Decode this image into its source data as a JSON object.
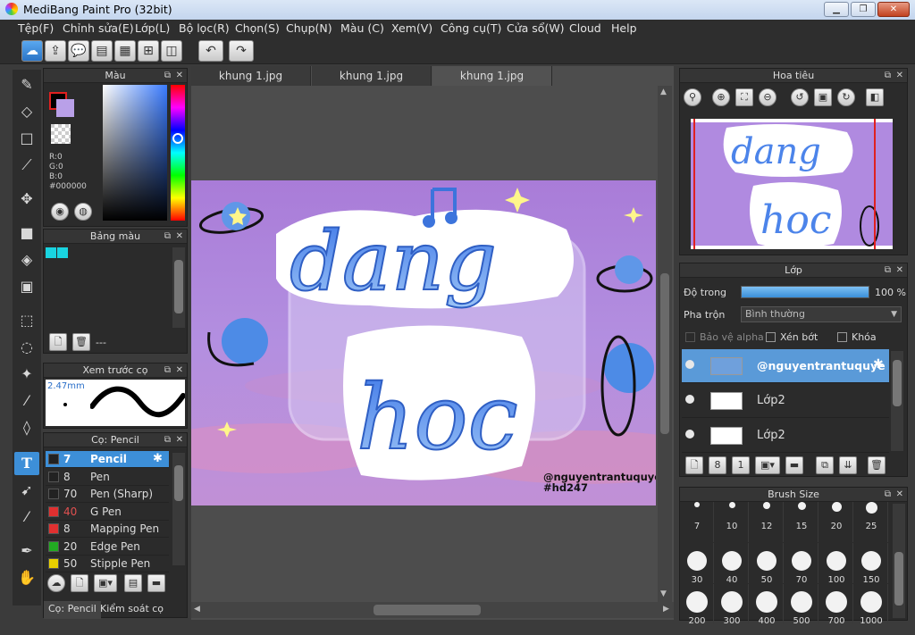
{
  "window": {
    "title": "MediBang Paint Pro (32bit)",
    "btn_min": "▁",
    "btn_max": "❐",
    "btn_close": "✕"
  },
  "menu": [
    "Tệp(F)",
    "Chỉnh sửa(E)",
    "Lớp(L)",
    "Bộ lọc(R)",
    "Chọn(S)",
    "Chụp(N)",
    "Màu (C)",
    "Xem(V)",
    "Công cụ(T)",
    "Cửa sổ(W)",
    "Cloud",
    "Help"
  ],
  "toolbar_icons": [
    "cloud-icon",
    "upload-icon",
    "comment-icon",
    "chat-icon",
    "page-icon",
    "grid-icon",
    "panel-icon",
    "undo-icon",
    "redo-icon"
  ],
  "tools": [
    "brush-icon",
    "eraser-icon",
    "rectangle-icon",
    "line-icon",
    "move-icon",
    "fill-rect-icon",
    "bucket-icon",
    "gradient-icon",
    "select-rect-icon",
    "lasso-icon",
    "magic-wand-icon",
    "select-pen-icon",
    "select-eraser-icon",
    "text-icon",
    "operation-icon",
    "eyedropper-icon",
    "dropper-icon",
    "hand-icon"
  ],
  "color_panel": {
    "title": "Màu",
    "fg": "#000000",
    "bg": "#b9a0e8",
    "rgb": {
      "r": "R:0",
      "g": "G:0",
      "b": "B:0",
      "hex": "#000000"
    }
  },
  "palette_panel": {
    "title": "Bảng màu",
    "swatches": [
      "#19d4e0",
      "#19d4e0"
    ],
    "dropdown": "---"
  },
  "preview_panel": {
    "title": "Xem trước cọ",
    "size": "2.47mm"
  },
  "brush_panel": {
    "title": "Cọ: Pencil",
    "items": [
      {
        "size": "7",
        "name": "Pencil",
        "color": "#222222"
      },
      {
        "size": "8",
        "name": "Pen",
        "color": "#222222"
      },
      {
        "size": "70",
        "name": "Pen (Sharp)",
        "color": "#222222"
      },
      {
        "size": "40",
        "name": "G Pen",
        "color": "#e03030"
      },
      {
        "size": "8",
        "name": "Mapping Pen",
        "color": "#e03030"
      },
      {
        "size": "20",
        "name": "Edge Pen",
        "color": "#22aa22"
      },
      {
        "size": "50",
        "name": "Stipple Pen",
        "color": "#e8d000"
      }
    ],
    "tab1": "Cọ: Pencil",
    "tab2": "Kiểm soát cọ"
  },
  "canvas_tabs": [
    "khung 1.jpg",
    "khung 1.jpg",
    "khung 1.jpg"
  ],
  "artwork": {
    "watermark1": "@nguyentrantuquyen",
    "watermark2": "#hd247"
  },
  "nav_panel": {
    "title": "Hoa tiêu"
  },
  "layer_panel": {
    "title": "Lớp",
    "opacity_label": "Độ trong",
    "opacity_value": "100 %",
    "opacity": 1.0,
    "blend_label": "Pha trộn",
    "blend_value": "Bình thường",
    "check_alpha": "Bảo vệ alpha",
    "check_clip": "Xén bớt",
    "check_lock": "Khóa",
    "layers": [
      "@nguyentrantuquye",
      "Lớp2",
      "Lớp2"
    ]
  },
  "brush_size_panel": {
    "title": "Brush Size",
    "sizes": [
      "7",
      "10",
      "12",
      "15",
      "20",
      "25",
      "30",
      "40",
      "50",
      "70",
      "100",
      "150",
      "200",
      "300",
      "400",
      "500",
      "700",
      "1000"
    ]
  }
}
